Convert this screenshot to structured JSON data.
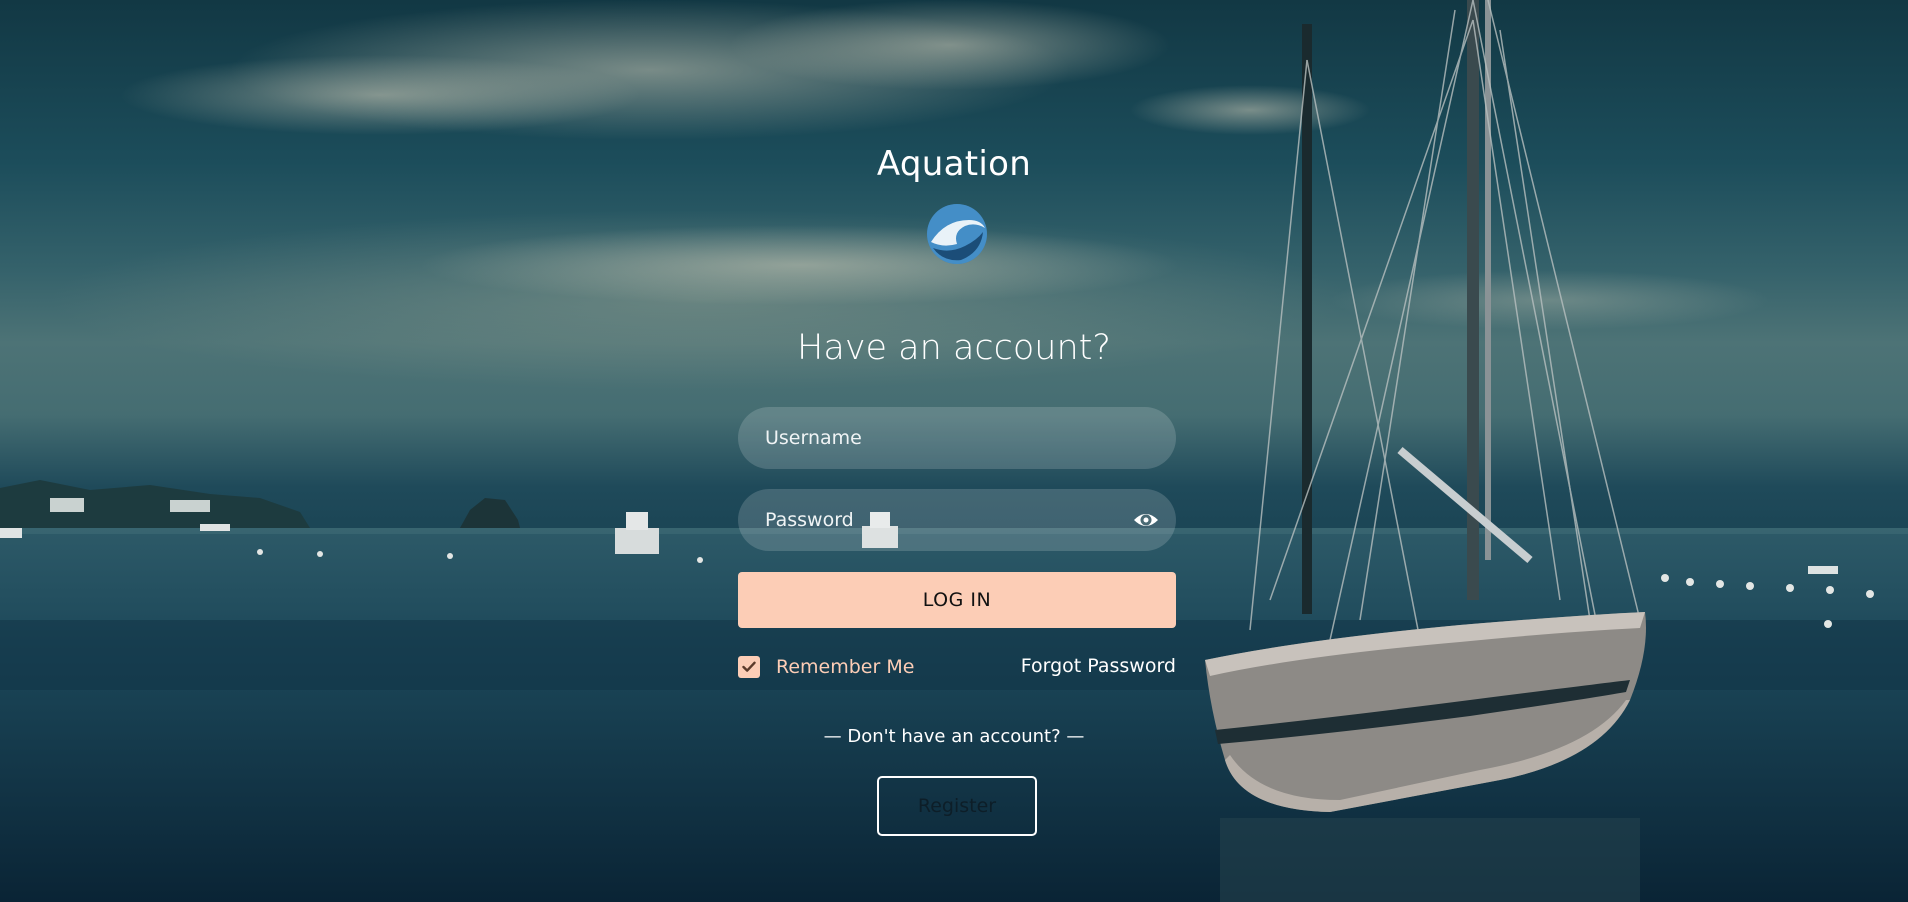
{
  "app": {
    "title": "Aquation",
    "logo_icon": "aquation-wave-logo-icon"
  },
  "login": {
    "headline": "Have an account?",
    "username_placeholder": "Username",
    "password_placeholder": "Password",
    "password_toggle_icon": "eye-icon",
    "login_label": "LOG IN",
    "remember_label": "Remember Me",
    "remember_checked": true,
    "forgot_label": "Forgot Password"
  },
  "signup": {
    "prompt": "— Don't have an account? —",
    "register_label": "Register"
  },
  "colors": {
    "accent": "#fccdb6",
    "text": "#ffffff",
    "field_bg": "rgba(255,255,255,0.16)",
    "logo_blue": "#3a8ed0"
  }
}
